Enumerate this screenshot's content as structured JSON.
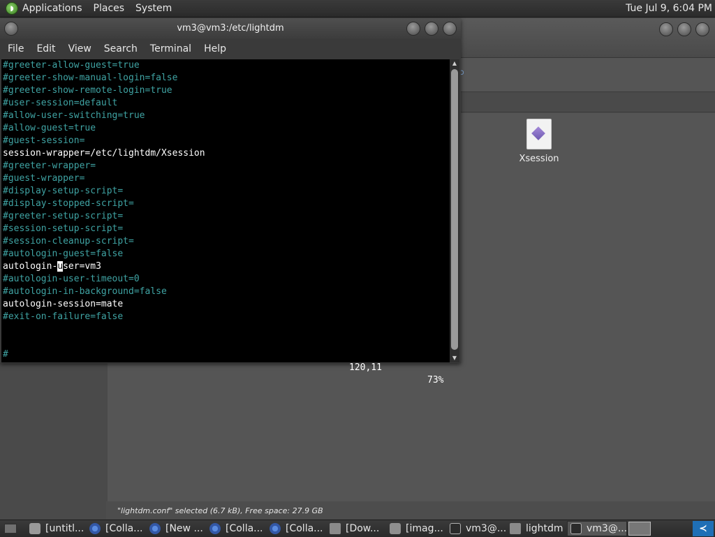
{
  "top_panel": {
    "menus": [
      "Applications",
      "Places",
      "System"
    ],
    "clock": "Tue Jul 9,  6:04 PM"
  },
  "file_manager": {
    "file": {
      "name": "Xsession"
    },
    "status": "\"lightdm.conf\" selected (6.7 kB), Free space: 27.9 GB"
  },
  "terminal": {
    "title": "vm3@vm3:/etc/lightdm",
    "menu": [
      "File",
      "Edit",
      "View",
      "Search",
      "Terminal",
      "Help"
    ],
    "lines": [
      {
        "text": "#greeter-allow-guest=true",
        "comment": true
      },
      {
        "text": "#greeter-show-manual-login=false",
        "comment": true
      },
      {
        "text": "#greeter-show-remote-login=true",
        "comment": true
      },
      {
        "text": "#user-session=default",
        "comment": true
      },
      {
        "text": "#allow-user-switching=true",
        "comment": true
      },
      {
        "text": "#allow-guest=true",
        "comment": true
      },
      {
        "text": "#guest-session=",
        "comment": true
      },
      {
        "text": "session-wrapper=/etc/lightdm/Xsession",
        "comment": false
      },
      {
        "text": "#greeter-wrapper=",
        "comment": true
      },
      {
        "text": "#guest-wrapper=",
        "comment": true
      },
      {
        "text": "#display-setup-script=",
        "comment": true
      },
      {
        "text": "#display-stopped-script=",
        "comment": true
      },
      {
        "text": "#greeter-setup-script=",
        "comment": true
      },
      {
        "text": "#session-setup-script=",
        "comment": true
      },
      {
        "text": "#session-cleanup-script=",
        "comment": true
      },
      {
        "text": "#autologin-guest=false",
        "comment": true
      },
      {
        "text": "autologin-user=vm3",
        "comment": false,
        "cursor_col": 10
      },
      {
        "text": "#autologin-user-timeout=0",
        "comment": true
      },
      {
        "text": "#autologin-in-background=false",
        "comment": true
      },
      {
        "text": "autologin-session=mate",
        "comment": false
      },
      {
        "text": "#exit-on-failure=false",
        "comment": true
      },
      {
        "text": "",
        "comment": false
      },
      {
        "text": "",
        "comment": false
      },
      {
        "text": "#",
        "comment": true
      }
    ],
    "status_position": "120,11",
    "status_percent": "73%"
  },
  "taskbar": {
    "tasks": [
      {
        "label": "[untitl...",
        "icon": "doc",
        "active": false
      },
      {
        "label": "[Colla...",
        "icon": "chrome",
        "active": false
      },
      {
        "label": "[New ...",
        "icon": "chrome",
        "active": false
      },
      {
        "label": "[Colla...",
        "icon": "chrome",
        "active": false
      },
      {
        "label": "[Colla...",
        "icon": "chrome",
        "active": false
      },
      {
        "label": "[Dow...",
        "icon": "folder",
        "active": false
      },
      {
        "label": "[imag...",
        "icon": "img",
        "active": false
      },
      {
        "label": "vm3@...",
        "icon": "term",
        "active": false
      },
      {
        "label": "lightdm",
        "icon": "folder",
        "active": false
      },
      {
        "label": "vm3@...",
        "icon": "term",
        "active": true
      }
    ]
  },
  "colors": {
    "comment_text": "#3fa3a3",
    "terminal_bg": "#000000",
    "panel_bg": "#2b2b2b"
  }
}
